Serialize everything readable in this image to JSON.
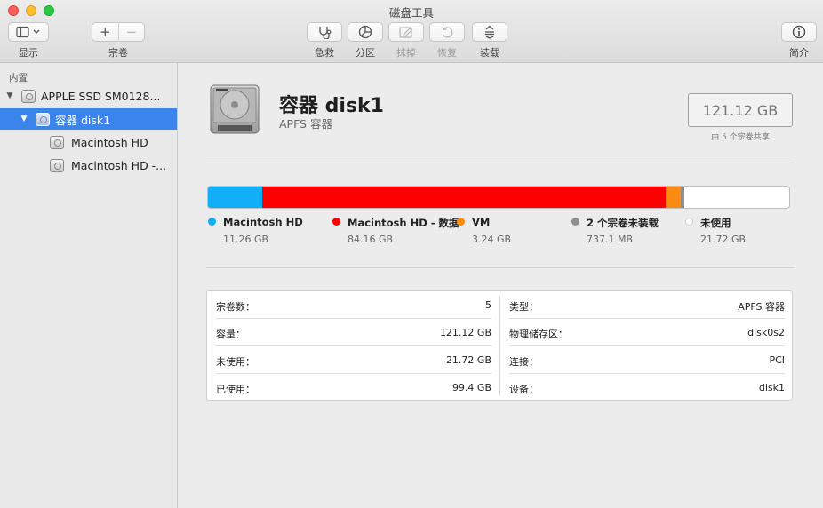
{
  "window": {
    "title": "磁盘工具"
  },
  "toolbar": {
    "view_label": "显示",
    "volume_label": "宗卷",
    "volume_add": "+",
    "volume_remove": "−",
    "first_aid_label": "急救",
    "partition_label": "分区",
    "erase_label": "抹掉",
    "restore_label": "恢复",
    "mount_label": "装载",
    "info_label": "简介"
  },
  "sidebar": {
    "section": "内置",
    "items": [
      {
        "label": "APPLE SSD SM0128...",
        "icon": "internal-disk-icon",
        "level": 0,
        "expanded": true
      },
      {
        "label": "容器 disk1",
        "icon": "container-icon",
        "level": 1,
        "expanded": true,
        "selected": true
      },
      {
        "label": "Macintosh HD",
        "icon": "volume-icon",
        "level": 2
      },
      {
        "label": "Macintosh HD -...",
        "icon": "volume-icon",
        "level": 2
      }
    ]
  },
  "main": {
    "title": "容器 disk1",
    "subtitle": "APFS 容器",
    "capacity": "121.12 GB",
    "capacity_caption": "由 5 个宗卷共享",
    "usage": [
      {
        "name": "Macintosh HD",
        "size": "11.26 GB",
        "gb": 11.26,
        "color": "#12aef8"
      },
      {
        "name": "Macintosh HD - 数据",
        "size": "84.16 GB",
        "gb": 84.16,
        "color": "#fe0000"
      },
      {
        "name": "VM",
        "size": "3.24 GB",
        "gb": 3.24,
        "color": "#fc8c11"
      },
      {
        "name": "2 个宗卷未装载",
        "size": "737.1 MB",
        "gb": 0.737,
        "color": "#8e8e8e"
      },
      {
        "name": "未使用",
        "size": "21.72 GB",
        "gb": 21.72,
        "color": "#ffffff"
      }
    ],
    "info_left": [
      {
        "key": "宗卷数：",
        "value": "5"
      },
      {
        "key": "容量：",
        "value": "121.12 GB"
      },
      {
        "key": "未使用：",
        "value": "21.72 GB"
      },
      {
        "key": "已使用：",
        "value": "99.4 GB"
      }
    ],
    "info_right": [
      {
        "key": "类型：",
        "value": "APFS 容器"
      },
      {
        "key": "物理储存区：",
        "value": "disk0s2"
      },
      {
        "key": "连接：",
        "value": "PCI"
      },
      {
        "key": "设备：",
        "value": "disk1"
      }
    ]
  }
}
